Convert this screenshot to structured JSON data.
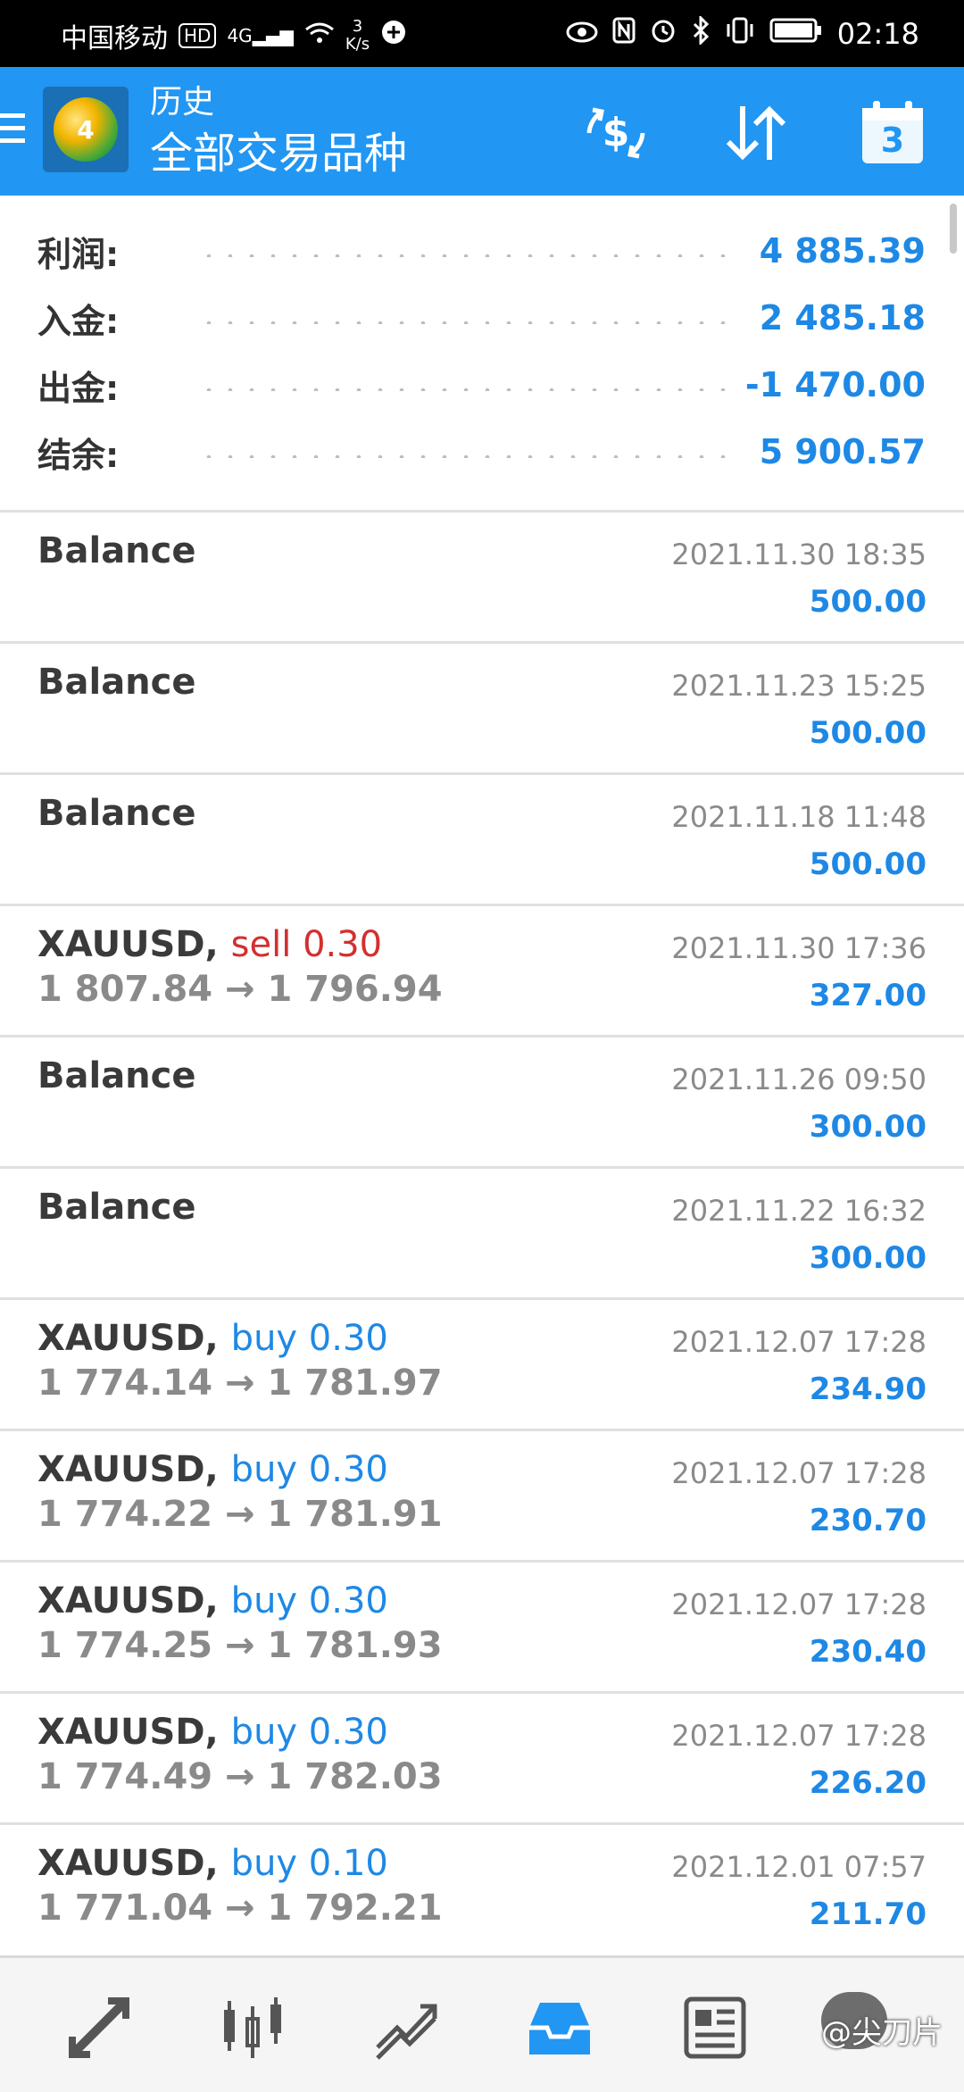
{
  "status_bar": {
    "carrier": "中国移动",
    "hd": "HD",
    "network": "4G",
    "speed_value": "3",
    "speed_unit": "K/s",
    "time": "02:18"
  },
  "app_bar": {
    "title": "历史",
    "subtitle": "全部交易品种",
    "calendar_day": "3",
    "logo_number": "4"
  },
  "summary": [
    {
      "label": "利润:",
      "value": "4 885.39"
    },
    {
      "label": "入金:",
      "value": "2 485.18"
    },
    {
      "label": "出金:",
      "value": "-1 470.00"
    },
    {
      "label": "结余:",
      "value": "5 900.57"
    }
  ],
  "deals": [
    {
      "symbol": "Balance",
      "side": "",
      "side_type": "",
      "prices": "",
      "date": "2021.11.30 18:35",
      "amount": "500.00"
    },
    {
      "symbol": "Balance",
      "side": "",
      "side_type": "",
      "prices": "",
      "date": "2021.11.23 15:25",
      "amount": "500.00"
    },
    {
      "symbol": "Balance",
      "side": "",
      "side_type": "",
      "prices": "",
      "date": "2021.11.18 11:48",
      "amount": "500.00"
    },
    {
      "symbol": "XAUUSD,",
      "side": "sell 0.30",
      "side_type": "sell",
      "prices": "1 807.84 → 1 796.94",
      "date": "2021.11.30 17:36",
      "amount": "327.00"
    },
    {
      "symbol": "Balance",
      "side": "",
      "side_type": "",
      "prices": "",
      "date": "2021.11.26 09:50",
      "amount": "300.00"
    },
    {
      "symbol": "Balance",
      "side": "",
      "side_type": "",
      "prices": "",
      "date": "2021.11.22 16:32",
      "amount": "300.00"
    },
    {
      "symbol": "XAUUSD,",
      "side": "buy 0.30",
      "side_type": "buy",
      "prices": "1 774.14 → 1 781.97",
      "date": "2021.12.07 17:28",
      "amount": "234.90"
    },
    {
      "symbol": "XAUUSD,",
      "side": "buy 0.30",
      "side_type": "buy",
      "prices": "1 774.22 → 1 781.91",
      "date": "2021.12.07 17:28",
      "amount": "230.70"
    },
    {
      "symbol": "XAUUSD,",
      "side": "buy 0.30",
      "side_type": "buy",
      "prices": "1 774.25 → 1 781.93",
      "date": "2021.12.07 17:28",
      "amount": "230.40"
    },
    {
      "symbol": "XAUUSD,",
      "side": "buy 0.30",
      "side_type": "buy",
      "prices": "1 774.49 → 1 782.03",
      "date": "2021.12.07 17:28",
      "amount": "226.20"
    },
    {
      "symbol": "XAUUSD,",
      "side": "buy 0.10",
      "side_type": "buy",
      "prices": "1 771.04 → 1 792.21",
      "date": "2021.12.01 07:57",
      "amount": "211.70"
    }
  ],
  "bottom_nav": [
    {
      "icon": "quotes-icon"
    },
    {
      "icon": "chart-icon"
    },
    {
      "icon": "trade-icon"
    },
    {
      "icon": "history-icon",
      "active": true
    },
    {
      "icon": "news-icon"
    },
    {
      "icon": "messages-icon"
    }
  ],
  "watermark": "@尖刀片",
  "colors": {
    "primary": "#2196f3",
    "value_blue": "#1e88e5",
    "sell_red": "#d32f2f",
    "muted": "#8a8a8a"
  }
}
